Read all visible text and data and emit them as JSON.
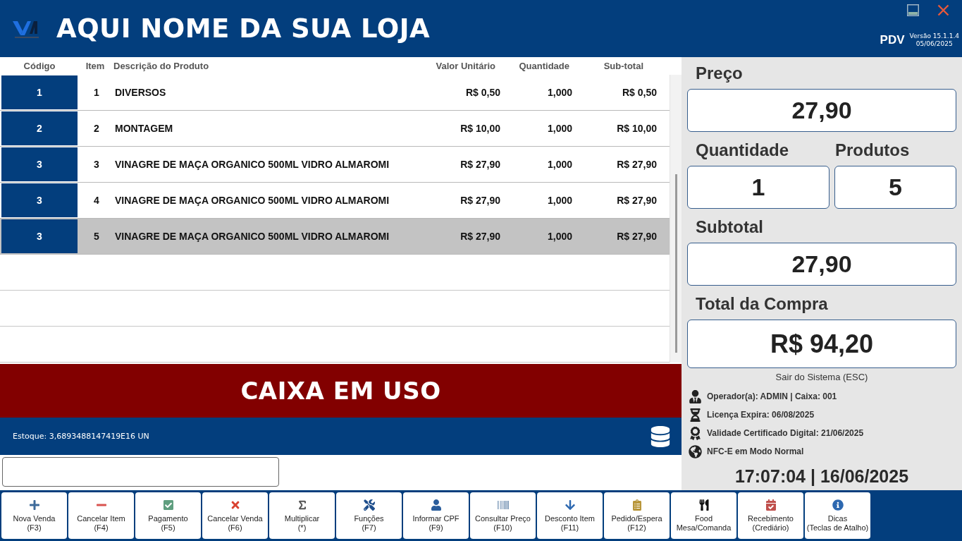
{
  "header": {
    "store_name": "AQUI NOME DA SUA LOJA",
    "app_label": "PDV",
    "version": "Versão 15.1.1.4",
    "version_date": "05/06/2025"
  },
  "table": {
    "columns": [
      "Código",
      "Item",
      "Descrição do Produto",
      "Valor Unitário",
      "Quantidade",
      "Sub-total"
    ],
    "rows": [
      {
        "code": "1",
        "item": "1",
        "description": "DIVERSOS",
        "unit_price": "R$ 0,50",
        "quantity": "1,000",
        "subtotal": "R$ 0,50",
        "selected": false
      },
      {
        "code": "2",
        "item": "2",
        "description": "MONTAGEM",
        "unit_price": "R$ 10,00",
        "quantity": "1,000",
        "subtotal": "R$ 10,00",
        "selected": false
      },
      {
        "code": "3",
        "item": "3",
        "description": "VINAGRE DE MAÇA ORGANICO 500ML VIDRO ALMAROMI",
        "unit_price": "R$ 27,90",
        "quantity": "1,000",
        "subtotal": "R$ 27,90",
        "selected": false
      },
      {
        "code": "3",
        "item": "4",
        "description": "VINAGRE DE MAÇA ORGANICO 500ML VIDRO ALMAROMI",
        "unit_price": "R$ 27,90",
        "quantity": "1,000",
        "subtotal": "R$ 27,90",
        "selected": false
      },
      {
        "code": "3",
        "item": "5",
        "description": "VINAGRE DE MAÇA ORGANICO 500ML VIDRO ALMAROMI",
        "unit_price": "R$ 27,90",
        "quantity": "1,000",
        "subtotal": "R$ 27,90",
        "selected": true
      }
    ]
  },
  "status_banner": "CAIXA EM USO",
  "stock": "Estoque: 3,6893488147419E16 UN",
  "summary": {
    "price": {
      "label": "Preço",
      "value": "27,90"
    },
    "quantity": {
      "label": "Quantidade",
      "value": "1"
    },
    "products": {
      "label": "Produtos",
      "value": "5"
    },
    "subtotal": {
      "label": "Subtotal",
      "value": "27,90"
    },
    "total": {
      "label": "Total da Compra",
      "value": "R$ 94,20"
    }
  },
  "exit_hint": "Sair do Sistema (ESC)",
  "info_lines": [
    {
      "kind": "operator",
      "text": "Operador(a): ADMIN | Caixa: 001"
    },
    {
      "kind": "license",
      "text": "Licença Expira: 06/08/2025"
    },
    {
      "kind": "certificate",
      "text": "Validade Certificado Digital: 21/06/2025"
    },
    {
      "kind": "nfce",
      "text": "NFC-E em Modo Normal"
    }
  ],
  "clock": "17:07:04 | 16/06/2025",
  "toolbar": [
    {
      "kind": "new",
      "lines": [
        "Nova Venda",
        "(F3)"
      ]
    },
    {
      "kind": "cancel_item",
      "lines": [
        "Cancelar Item",
        "(F4)"
      ]
    },
    {
      "kind": "payment",
      "lines": [
        "Pagamento",
        "(F5)"
      ]
    },
    {
      "kind": "cancel_sale",
      "lines": [
        "Cancelar Venda",
        "(F6)"
      ]
    },
    {
      "kind": "multiply",
      "lines": [
        "Multiplicar",
        "(*)"
      ]
    },
    {
      "kind": "functions",
      "lines": [
        "Funções",
        "(F7)"
      ]
    },
    {
      "kind": "cpf",
      "lines": [
        "Informar CPF",
        "(F9)"
      ]
    },
    {
      "kind": "price_check",
      "lines": [
        "Consultar Preço",
        "(F10)"
      ]
    },
    {
      "kind": "discount",
      "lines": [
        "Desconto Item",
        "(F11)"
      ]
    },
    {
      "kind": "hold",
      "lines": [
        "Pedido/Espera",
        "(F12)"
      ]
    },
    {
      "kind": "food",
      "lines": [
        "Food",
        "Mesa/Comanda"
      ]
    },
    {
      "kind": "receipts",
      "lines": [
        "Recebimento",
        "(Crediário)"
      ]
    },
    {
      "kind": "tips",
      "lines": [
        "Dicas",
        "(Teclas de Atalho)"
      ]
    }
  ]
}
